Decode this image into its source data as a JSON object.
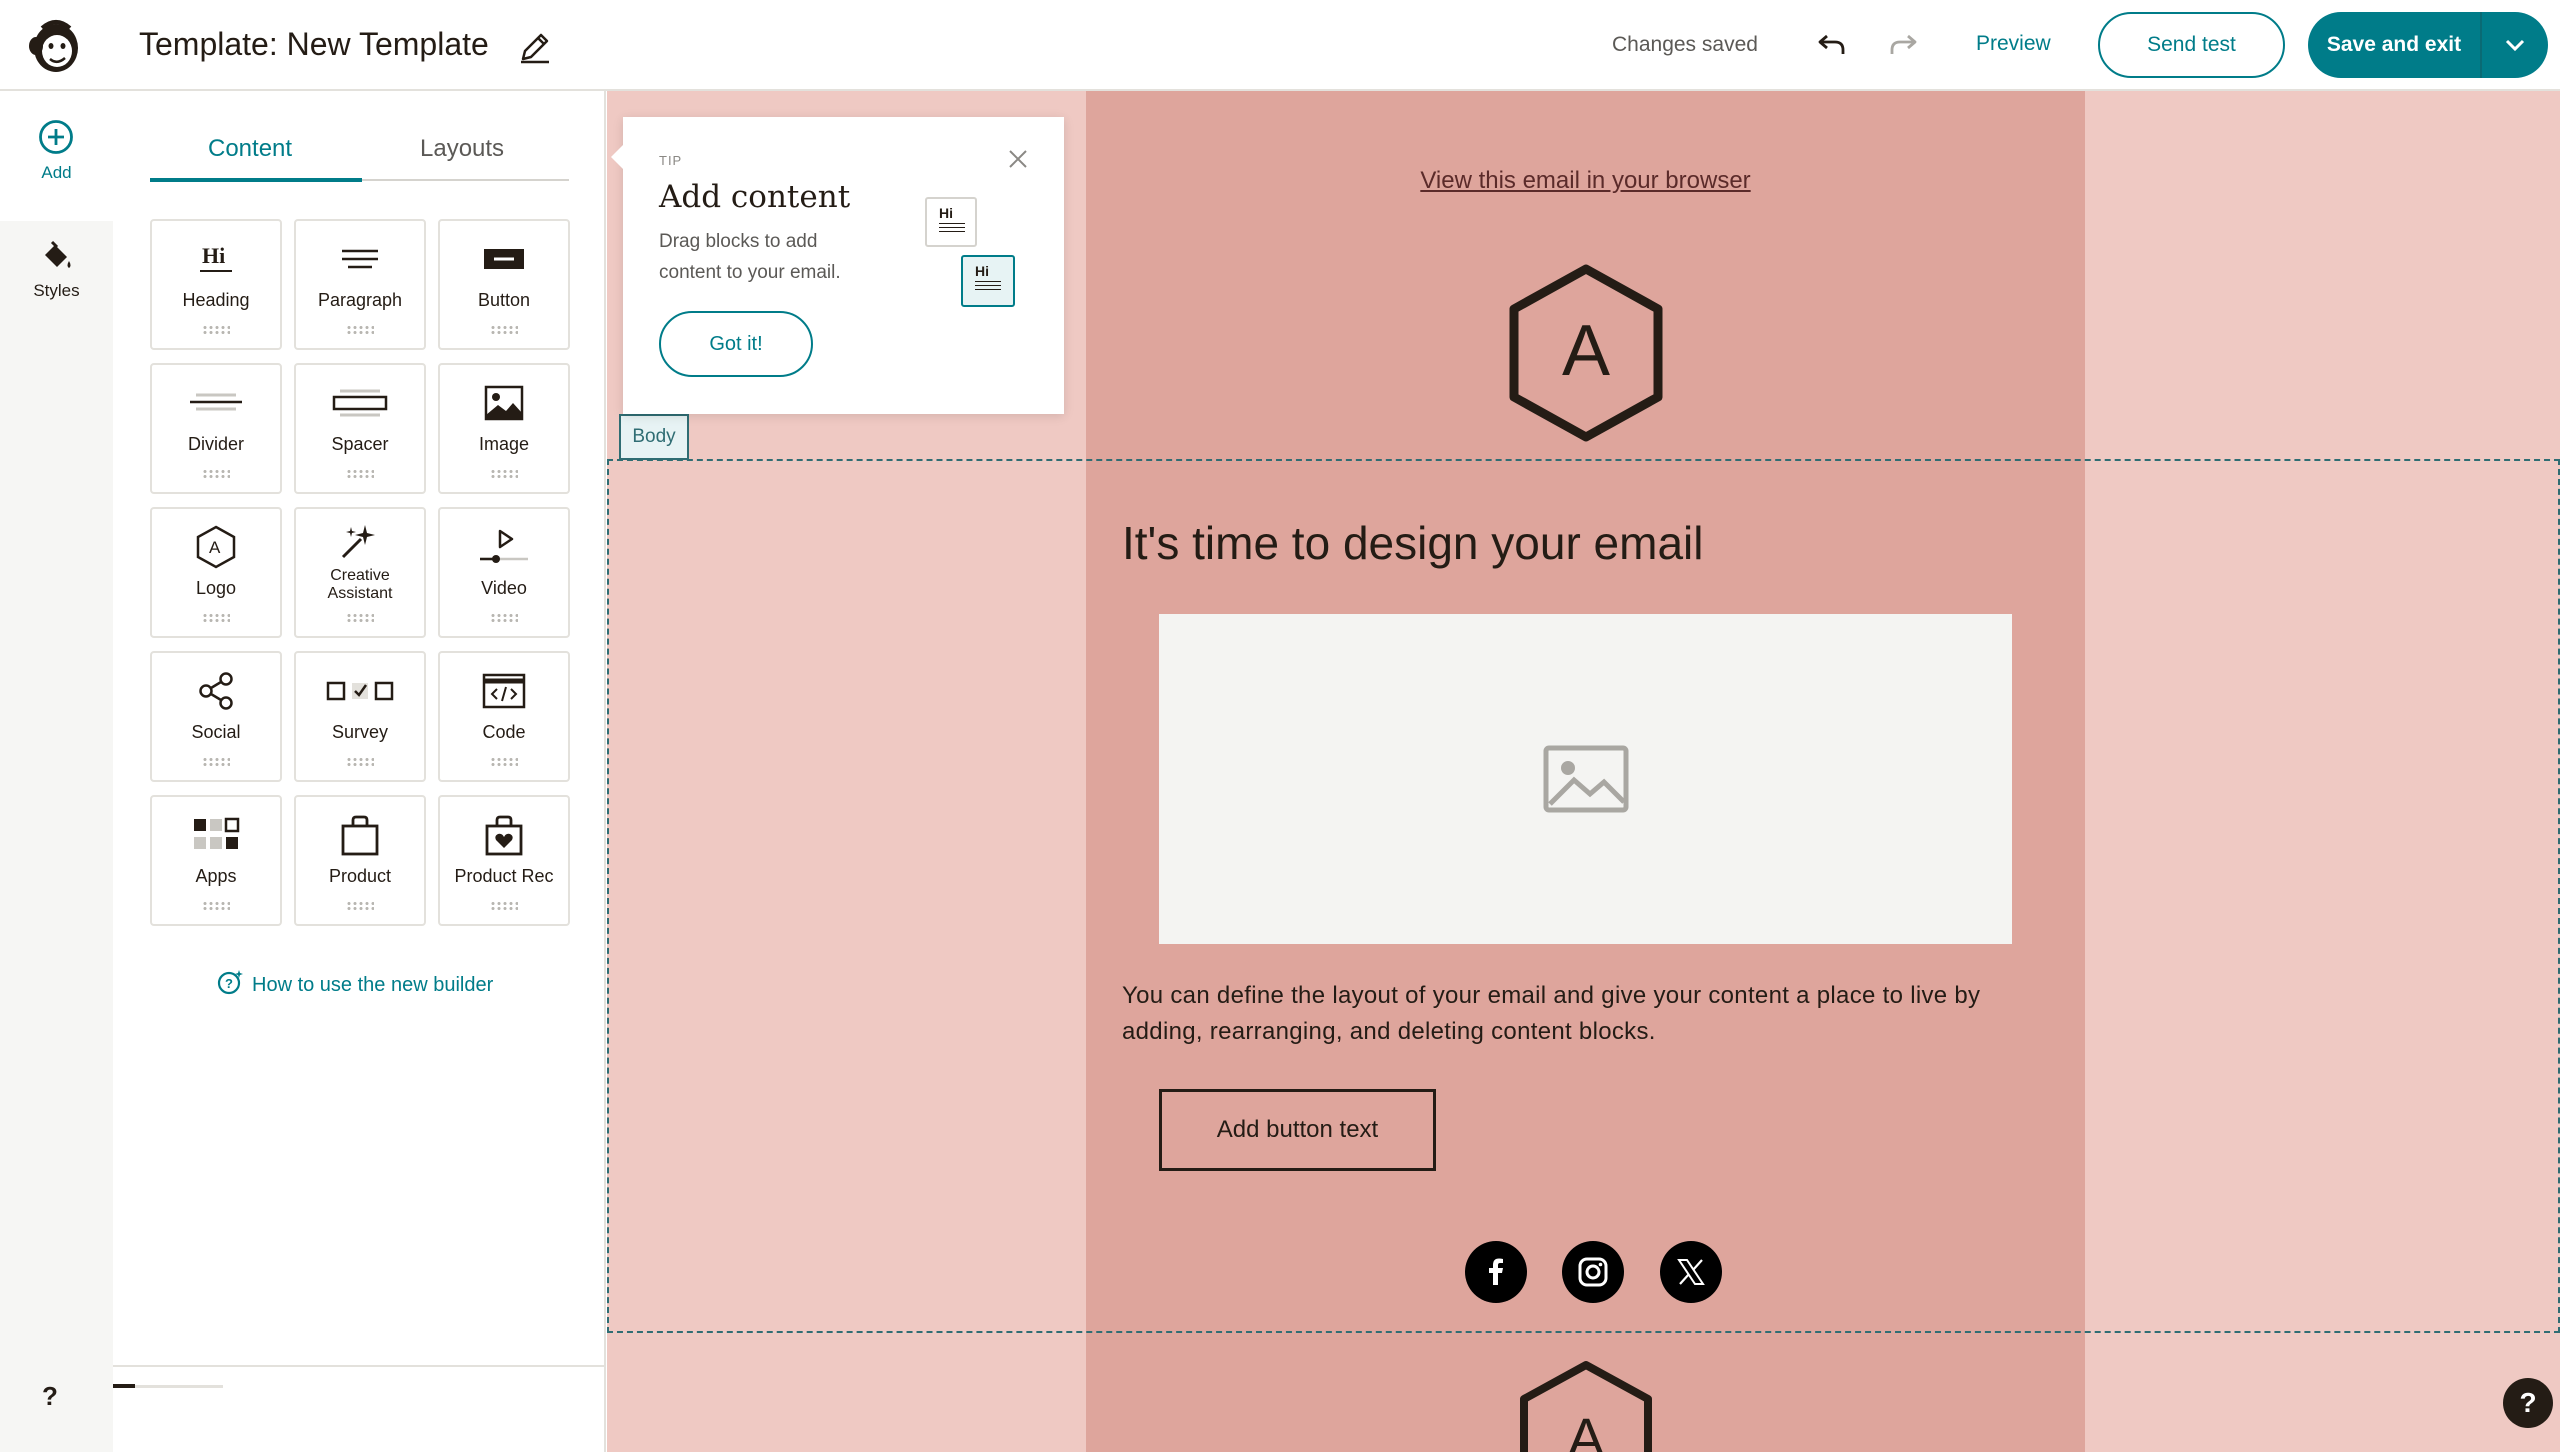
{
  "header": {
    "title": "Template: New Template",
    "status": "Changes saved",
    "preview_label": "Preview",
    "send_test_label": "Send test",
    "save_exit_label": "Save and exit"
  },
  "rail": {
    "add_label": "Add",
    "styles_label": "Styles",
    "help_label": "?"
  },
  "panel": {
    "tabs": [
      {
        "label": "Content",
        "active": true
      },
      {
        "label": "Layouts",
        "active": false
      }
    ],
    "blocks": [
      {
        "label": "Heading",
        "icon": "heading-icon"
      },
      {
        "label": "Paragraph",
        "icon": "paragraph-icon"
      },
      {
        "label": "Button",
        "icon": "button-icon"
      },
      {
        "label": "Divider",
        "icon": "divider-icon"
      },
      {
        "label": "Spacer",
        "icon": "spacer-icon"
      },
      {
        "label": "Image",
        "icon": "image-icon"
      },
      {
        "label": "Logo",
        "icon": "logo-icon"
      },
      {
        "label": "Creative Assistant",
        "icon": "creative-assistant-icon"
      },
      {
        "label": "Video",
        "icon": "video-icon"
      },
      {
        "label": "Social",
        "icon": "social-icon"
      },
      {
        "label": "Survey",
        "icon": "survey-icon"
      },
      {
        "label": "Code",
        "icon": "code-icon"
      },
      {
        "label": "Apps",
        "icon": "apps-icon"
      },
      {
        "label": "Product",
        "icon": "product-icon"
      },
      {
        "label": "Product Rec",
        "icon": "product-rec-icon"
      }
    ],
    "howto_label": "How to use the new builder"
  },
  "tip": {
    "label": "TIP",
    "title": "Add content",
    "text": "Drag blocks to add content to your email.",
    "button_label": "Got it!",
    "card_text": "Hi"
  },
  "email": {
    "view_browser": "View this email in your browser",
    "logo_letter": "A",
    "body_tag": "Body",
    "headline": "It's time to design your email",
    "paragraph": "You can define the layout of your email and give your content a place to live by adding, rearranging, and deleting content blocks.",
    "button_label": "Add button text",
    "socials": [
      "facebook-icon",
      "instagram-icon",
      "x-icon"
    ]
  },
  "colors": {
    "accent": "#007c89",
    "canvas_bg": "#efc9c3",
    "email_bg": "#dea59c",
    "text": "#241c15"
  }
}
